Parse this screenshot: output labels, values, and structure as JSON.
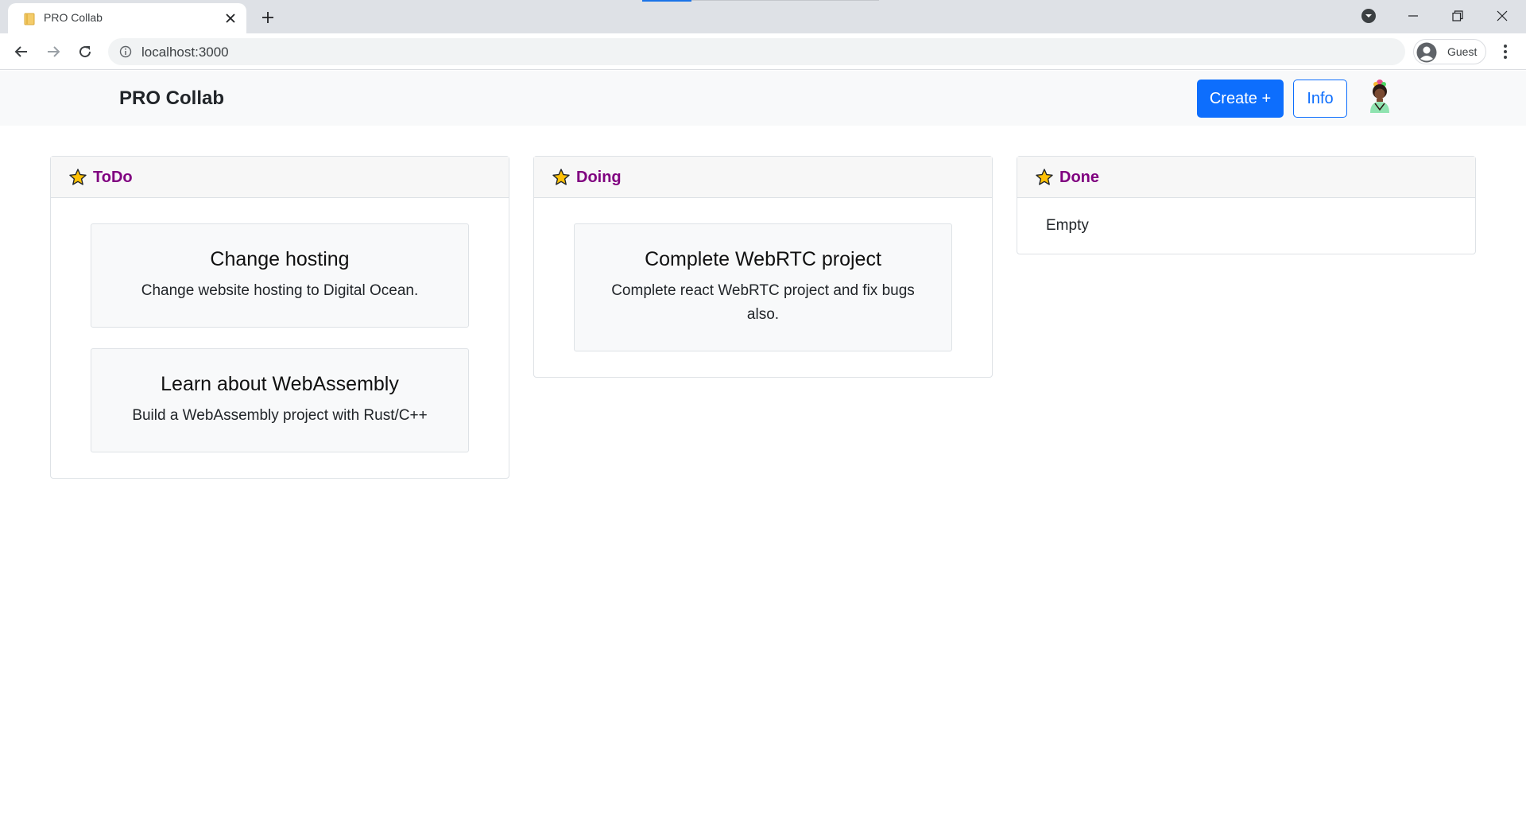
{
  "browser": {
    "tab_title": "PRO Collab",
    "url": "localhost:3000",
    "profile_label": "Guest"
  },
  "navbar": {
    "brand": "PRO Collab",
    "create_label": "Create +",
    "info_label": "Info"
  },
  "board": {
    "columns": [
      {
        "title": "ToDo",
        "cards": [
          {
            "title": "Change hosting",
            "description": "Change website hosting to Digital Ocean."
          },
          {
            "title": "Learn about WebAssembly",
            "description": "Build a WebAssembly project with Rust/C++"
          }
        ]
      },
      {
        "title": "Doing",
        "cards": [
          {
            "title": "Complete WebRTC project",
            "description": "Complete react WebRTC project and fix bugs also."
          }
        ]
      },
      {
        "title": "Done",
        "empty_text": "Empty"
      }
    ]
  },
  "colors": {
    "primary": "#0d6efd",
    "column_title": "#800080",
    "star_fill": "#ffc107",
    "navbar_bg": "#f8f9fa"
  }
}
